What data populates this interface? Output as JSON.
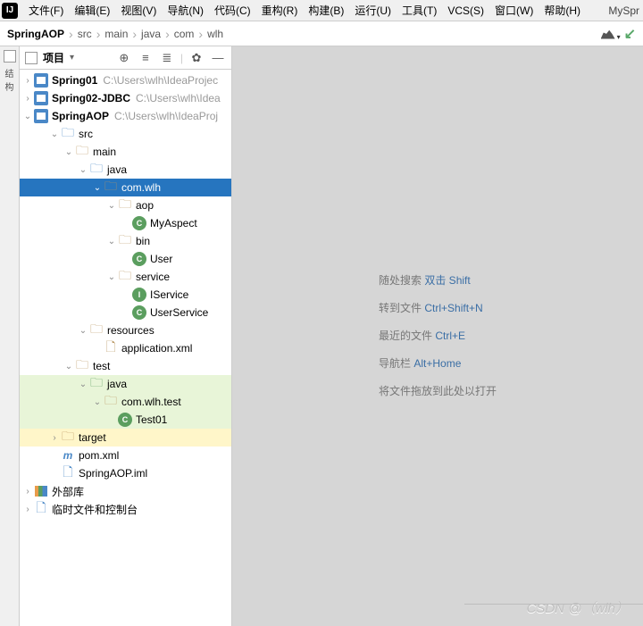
{
  "menu": {
    "items": [
      "文件(F)",
      "编辑(E)",
      "视图(V)",
      "导航(N)",
      "代码(C)",
      "重构(R)",
      "构建(B)",
      "运行(U)",
      "工具(T)",
      "VCS(S)",
      "窗口(W)",
      "帮助(H)"
    ],
    "project": "MySpr"
  },
  "breadcrumb": [
    "SpringAOP",
    "src",
    "main",
    "java",
    "com",
    "wlh"
  ],
  "sidebar": {
    "title": "项目"
  },
  "tree": {
    "p1": {
      "name": "Spring01",
      "path": "C:\\Users\\wlh\\IdeaProjec"
    },
    "p2": {
      "name": "Spring02-JDBC",
      "path": "C:\\Users\\wlh\\Idea"
    },
    "p3": {
      "name": "SpringAOP",
      "path": "C:\\Users\\wlh\\IdeaProj"
    },
    "src": "src",
    "main": "main",
    "java": "java",
    "comwlh": "com.wlh",
    "aop": "aop",
    "myaspect": "MyAspect",
    "bin": "bin",
    "user": "User",
    "service": "service",
    "iservice": "IService",
    "userservice": "UserService",
    "resources": "resources",
    "appxml": "application.xml",
    "test": "test",
    "java2": "java",
    "testpkg": "com.wlh.test",
    "test01": "Test01",
    "target": "target",
    "pom": "pom.xml",
    "iml": "SpringAOP.iml",
    "extlib": "外部库",
    "scratch": "临时文件和控制台"
  },
  "welcome": {
    "l1a": "随处搜索",
    "l1b": "双击 Shift",
    "l2a": "转到文件",
    "l2b": "Ctrl+Shift+N",
    "l3a": "最近的文件",
    "l3b": "Ctrl+E",
    "l4a": "导航栏",
    "l4b": "Alt+Home",
    "l5": "将文件拖放到此处以打开"
  },
  "watermark": "CSDN @（wlh）"
}
